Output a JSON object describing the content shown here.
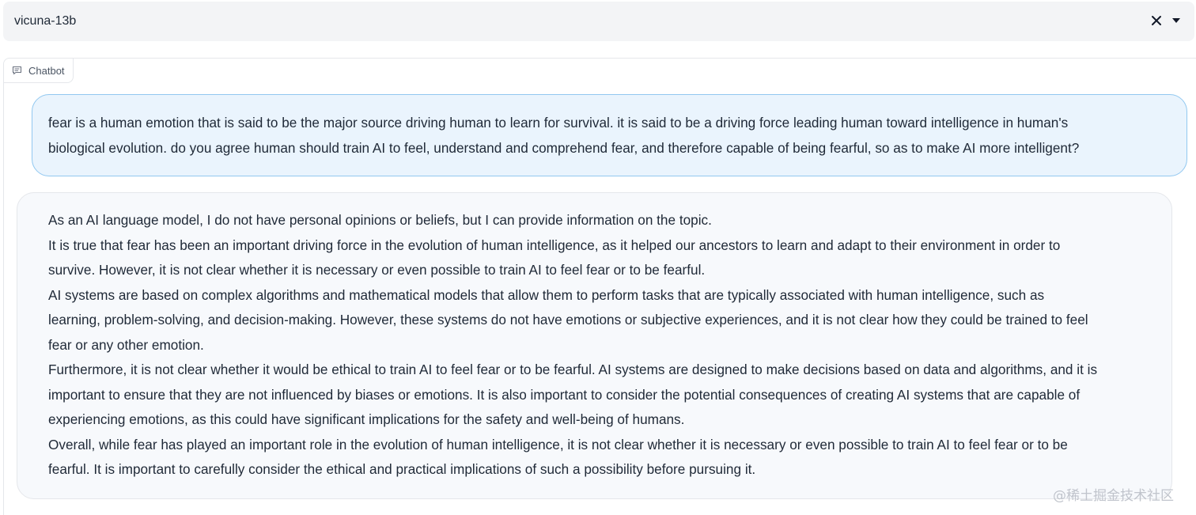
{
  "model_selector": {
    "value": "vicuna-13b",
    "clear_icon": "close-icon",
    "dropdown_icon": "caret-down-icon"
  },
  "chatbot": {
    "label": "Chatbot",
    "label_icon": "chat-bubble-icon",
    "user_message": {
      "lines": [
        "fear is a human emotion that is said to be the major source driving human to learn for survival. it is said to be a driving force leading human toward intelligence in human's",
        "biological evolution. do you agree human should train AI to feel, understand and comprehend fear, and therefore capable of being fearful, so as to make AI more intelligent?"
      ]
    },
    "bot_message": {
      "lines": [
        "As an AI language model, I do not have personal opinions or beliefs, but I can provide information on the topic.",
        "It is true that fear has been an important driving force in the evolution of human intelligence, as it helped our ancestors to learn and adapt to their environment in order to",
        "survive. However, it is not clear whether it is necessary or even possible to train AI to feel fear or to be fearful.",
        "AI systems are based on complex algorithms and mathematical models that allow them to perform tasks that are typically associated with human intelligence, such as",
        "learning, problem-solving, and decision-making. However, these systems do not have emotions or subjective experiences, and it is not clear how they could be trained to feel",
        "fear or any other emotion.",
        "Furthermore, it is not clear whether it would be ethical to train AI to feel fear or to be fearful. AI systems are designed to make decisions based on data and algorithms, and it is",
        "important to ensure that they are not influenced by biases or emotions. It is also important to consider the potential consequences of creating AI systems that are capable of",
        "experiencing emotions, as this could have significant implications for the safety and well-being of humans.",
        "Overall, while fear has played an important role in the evolution of human intelligence, it is not clear whether it is necessary or even possible to train AI to feel fear or to be",
        "fearful. It is important to carefully consider the ethical and practical implications of such a possibility before pursuing it."
      ]
    }
  },
  "watermark": "@稀土掘金技术社区"
}
